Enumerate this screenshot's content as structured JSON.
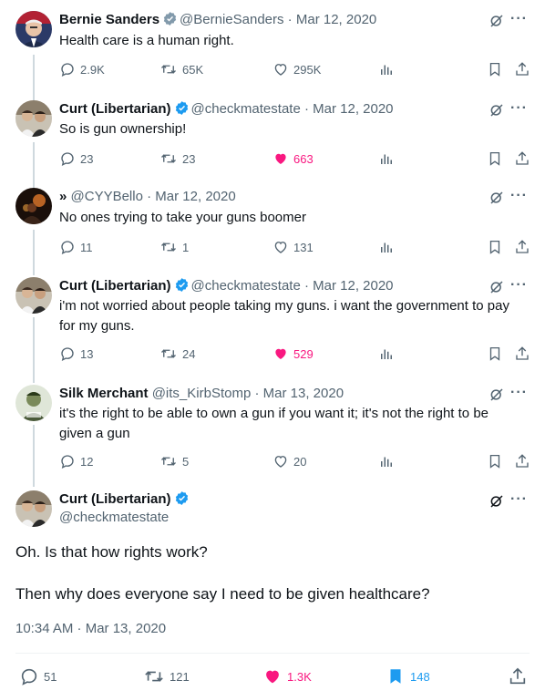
{
  "tweets": [
    {
      "name": "Bernie Sanders",
      "verified": true,
      "handle": "@BernieSanders",
      "date": "Mar 12, 2020",
      "text": "Health care is a human right.",
      "replies": "2.9K",
      "retweets": "65K",
      "likes": "295K",
      "liked": false
    },
    {
      "name": "Curt (Libertarian)",
      "verified": true,
      "handle": "@checkmatestate",
      "date": "Mar 12, 2020",
      "text": "So is gun ownership!",
      "replies": "23",
      "retweets": "23",
      "likes": "663",
      "liked": true
    },
    {
      "name": "»",
      "verified": false,
      "handle": "@CYYBello",
      "date": "Mar 12, 2020",
      "text": "No ones trying to take your guns boomer",
      "replies": "11",
      "retweets": "1",
      "likes": "131",
      "liked": false
    },
    {
      "name": "Curt (Libertarian)",
      "verified": true,
      "handle": "@checkmatestate",
      "date": "Mar 12, 2020",
      "text": "i'm not worried about people taking my guns. i want the government to pay for my guns.",
      "replies": "13",
      "retweets": "24",
      "likes": "529",
      "liked": true
    },
    {
      "name": "Silk Merchant",
      "verified": false,
      "handle": "@its_KirbStomp",
      "date": "Mar 13, 2020",
      "text": "it's the right to be able to own a gun if you want it; it's not the right to be given a gun",
      "replies": "12",
      "retweets": "5",
      "likes": "20",
      "liked": false
    }
  ],
  "main_tweet": {
    "name": "Curt (Libertarian)",
    "verified": true,
    "handle": "@checkmatestate",
    "line1": "Oh. Is that how rights work?",
    "line2": "Then why does everyone say I need to be given healthcare?",
    "timestamp": "10:34 AM · Mar 13, 2020",
    "replies": "51",
    "retweets": "121",
    "likes": "1.3K",
    "bookmarks": "148"
  },
  "icons": {
    "reply": "reply-icon",
    "retweet": "retweet-icon",
    "like": "heart-icon",
    "views": "analytics-icon",
    "bookmark": "bookmark-icon",
    "share": "share-icon",
    "grok": "grok-icon",
    "more": "more-icon",
    "verified": "verified-badge-icon"
  },
  "colors": {
    "text": "#0f1419",
    "muted": "#536471",
    "like": "#f91880",
    "accent": "#1d9bf0",
    "thread_line": "#cfd9de"
  }
}
